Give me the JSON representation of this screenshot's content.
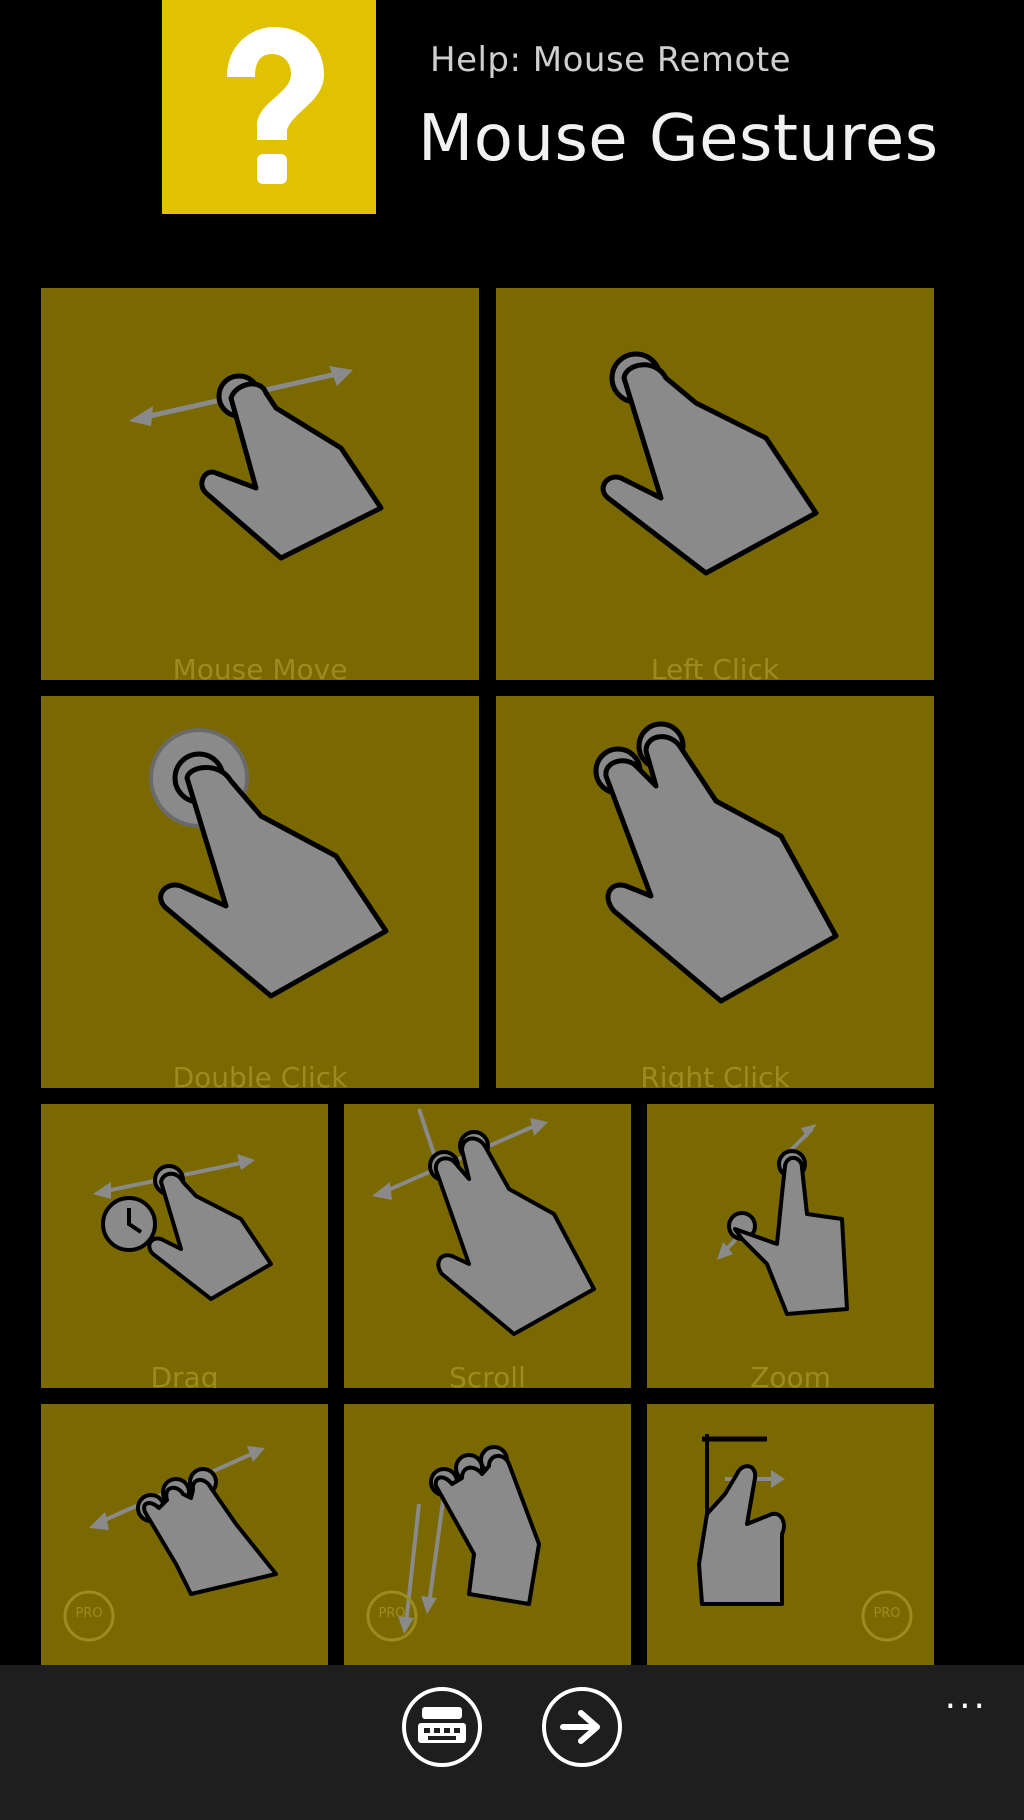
{
  "header": {
    "subtitle": "Help: Mouse Remote",
    "title": "Mouse Gestures",
    "icon": "question-mark-icon",
    "accent": "#e0c200"
  },
  "tile_color": "#7a6900",
  "tiles": [
    {
      "label": "Mouse Move",
      "icon": "one-finger-swipe-icon"
    },
    {
      "label": "Left Click",
      "icon": "one-finger-tap-icon"
    },
    {
      "label": "Double Click",
      "icon": "double-tap-icon"
    },
    {
      "label": "Right Click",
      "icon": "two-finger-tap-icon"
    },
    {
      "label": "Drag",
      "icon": "tap-hold-drag-icon"
    },
    {
      "label": "Scroll",
      "icon": "two-finger-scroll-icon"
    },
    {
      "label": "Zoom",
      "icon": "pinch-zoom-icon"
    },
    {
      "label": "",
      "icon": "three-finger-swipe-icon",
      "badge": "PRO"
    },
    {
      "label": "",
      "icon": "three-finger-down-icon",
      "badge": "PRO"
    },
    {
      "label": "",
      "icon": "edge-swipe-icon",
      "badge": "PRO"
    }
  ],
  "appbar": {
    "buttons": [
      "keyboard-mouse-icon",
      "arrow-right-icon"
    ],
    "more": "..."
  }
}
